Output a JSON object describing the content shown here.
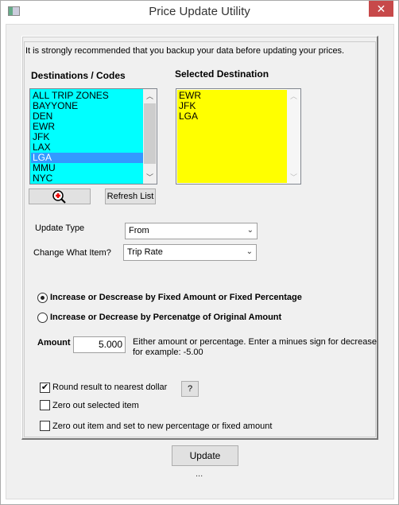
{
  "window": {
    "title": "Price Update Utility",
    "close_label": "✕"
  },
  "warning": "It is strongly recommended that you backup your data before updating your prices.",
  "destinations": {
    "label": "Destinations / Codes",
    "items": [
      "ALL TRIP ZONES",
      "BAYYONE",
      "DEN",
      "EWR",
      "JFK",
      "LAX",
      "LGA",
      "MMU",
      "NYC"
    ],
    "selected": "LGA",
    "background": "#00ffff",
    "highlight": "#3399ff"
  },
  "selected_destination": {
    "label": "Selected Destination",
    "items": [
      "EWR",
      "JFK",
      "LGA"
    ],
    "background": "#ffff00"
  },
  "buttons": {
    "refresh": "Refresh List",
    "help": "?",
    "update": "Update"
  },
  "update_type": {
    "label": "Update Type",
    "value": "From"
  },
  "change_item": {
    "label": "Change What Item?",
    "value": "Trip Rate"
  },
  "radios": [
    {
      "label": "Increase or Descrease by Fixed Amount or Fixed Percentage",
      "checked": true
    },
    {
      "label": "Increase or Decrease by Percenatge of Original Amount",
      "checked": false
    }
  ],
  "amount": {
    "label": "Amount",
    "value": "5.000",
    "help_line1": "Either amount or percentage. Enter a minues sign for decrease",
    "help_line2": "for example:  -5.00"
  },
  "checkboxes": [
    {
      "label": "Round result to nearest dollar",
      "checked": true
    },
    {
      "label": "Zero out selected item",
      "checked": false
    },
    {
      "label": "Zero out item and set to new percentage or fixed amount",
      "checked": false
    }
  ],
  "status": "..."
}
